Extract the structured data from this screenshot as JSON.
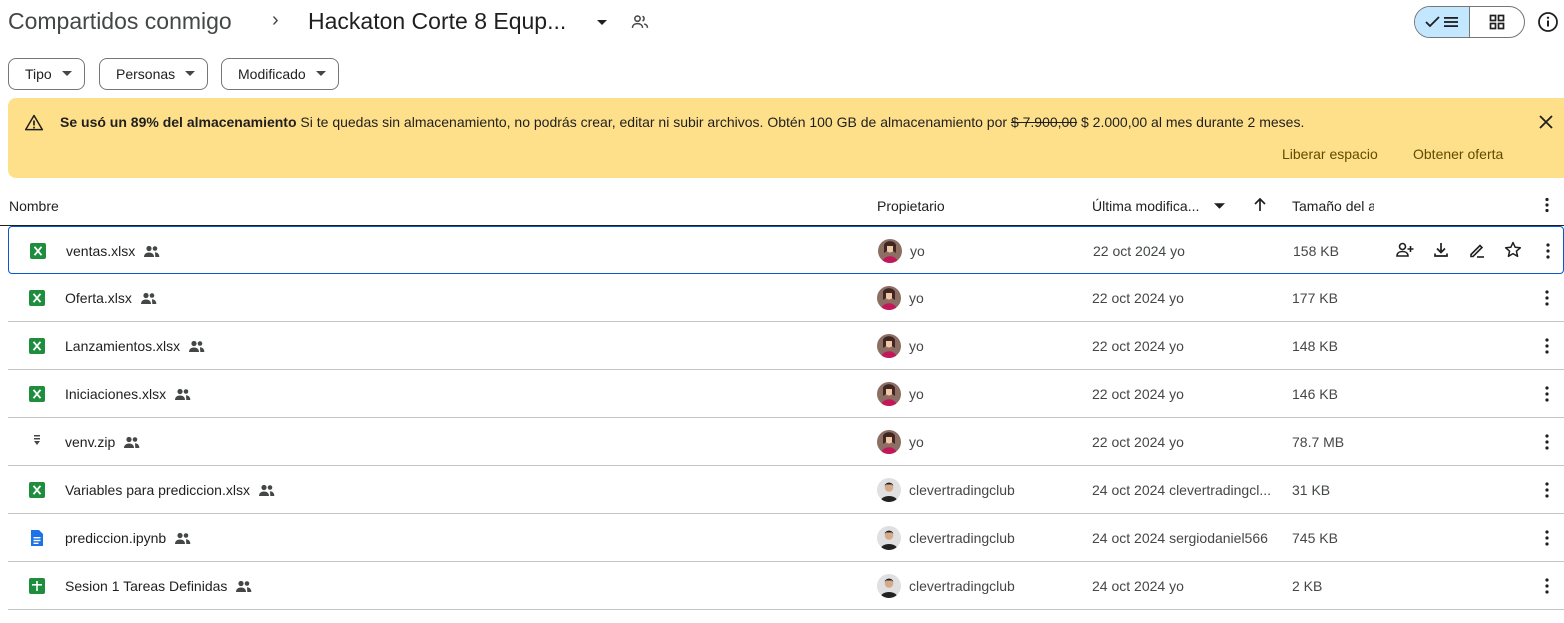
{
  "header": {
    "breadcrumb_root": "Compartidos conmigo",
    "breadcrumb_sep": "›",
    "folder_name": "Hackaton Corte 8 Equp..."
  },
  "filters": [
    {
      "label": "Tipo"
    },
    {
      "label": "Personas"
    },
    {
      "label": "Modificado"
    }
  ],
  "banner": {
    "bold_text": "Se usó un 89% del almacenamiento",
    "body_text": " Si te quedas sin almacenamiento, no podrás crear, editar ni subir archivos. Obtén 100 GB de almacenamiento por ",
    "old_price": "$ 7.900,00",
    "new_price_text": " $ 2.000,00 al mes durante 2 meses.",
    "link_free": "Liberar espacio",
    "link_offer": "Obtener oferta",
    "color": "#ffe08a"
  },
  "table": {
    "headers": {
      "name": "Nombre",
      "owner": "Propietario",
      "modified": "Última modifica...",
      "size": "Tamaño del a"
    },
    "rows": [
      {
        "name": "ventas.xlsx",
        "icon": "excel-icon",
        "owner": "yo",
        "avatar": "avatar-yo",
        "date": "22 oct 2024",
        "modby": "yo",
        "size": "158 KB"
      },
      {
        "name": "Oferta.xlsx",
        "icon": "excel-icon",
        "owner": "yo",
        "avatar": "avatar-yo",
        "date": "22 oct 2024",
        "modby": "yo",
        "size": "177 KB"
      },
      {
        "name": "Lanzamientos.xlsx",
        "icon": "excel-icon",
        "owner": "yo",
        "avatar": "avatar-yo",
        "date": "22 oct 2024",
        "modby": "yo",
        "size": "148 KB"
      },
      {
        "name": "Iniciaciones.xlsx",
        "icon": "excel-icon",
        "owner": "yo",
        "avatar": "avatar-yo",
        "date": "22 oct 2024",
        "modby": "yo",
        "size": "146 KB"
      },
      {
        "name": "venv.zip",
        "icon": "zip-icon",
        "owner": "yo",
        "avatar": "avatar-yo",
        "date": "22 oct 2024",
        "modby": "yo",
        "size": "78.7 MB"
      },
      {
        "name": "Variables para prediccion.xlsx",
        "icon": "excel-icon",
        "owner": "clevertradingclub",
        "avatar": "avatar-clever",
        "date": "24 oct 2024",
        "modby": "clevertradingcl...",
        "size": "31 KB"
      },
      {
        "name": "prediccion.ipynb",
        "icon": "doc-icon",
        "owner": "clevertradingclub",
        "avatar": "avatar-clever",
        "date": "24 oct 2024",
        "modby": "sergiodaniel566",
        "size": "745 KB"
      },
      {
        "name": "Sesion 1 Tareas Definidas",
        "icon": "sheets-icon",
        "owner": "clevertradingclub",
        "avatar": "avatar-clever",
        "date": "24 oct 2024",
        "modby": "yo",
        "size": "2 KB"
      }
    ]
  },
  "colors": {
    "excel": "#1e8e3e",
    "doc": "#1a73e8",
    "accent_selected": "#c2e7ff",
    "row_selected_border": "#0b57d0"
  }
}
